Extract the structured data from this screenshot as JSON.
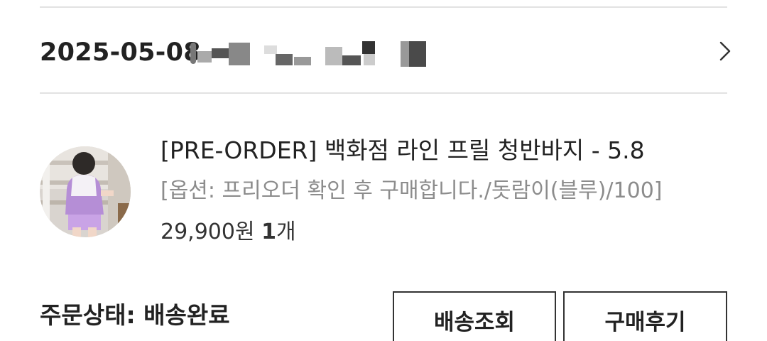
{
  "order": {
    "date": "2025-05-08"
  },
  "product": {
    "name": "[PRE-ORDER] 백화점 라인 프릴 청반바지 - 5.8",
    "option": "[옵션: 프리오더 확인 후 구매합니다./돗람이(블루)/100]",
    "price": "29,900원",
    "quantity": "1",
    "quantity_unit": "개"
  },
  "status": {
    "text": "주문상태: 배송완료"
  },
  "buttons": {
    "track_label": "배송조회",
    "review_label": "구매후기"
  },
  "icons": {
    "chevron": "chevron-right-icon"
  },
  "colors": {
    "text": "#222222",
    "muted": "#8c8c8c",
    "divider": "#e2e2e2",
    "button_border": "#333333"
  }
}
